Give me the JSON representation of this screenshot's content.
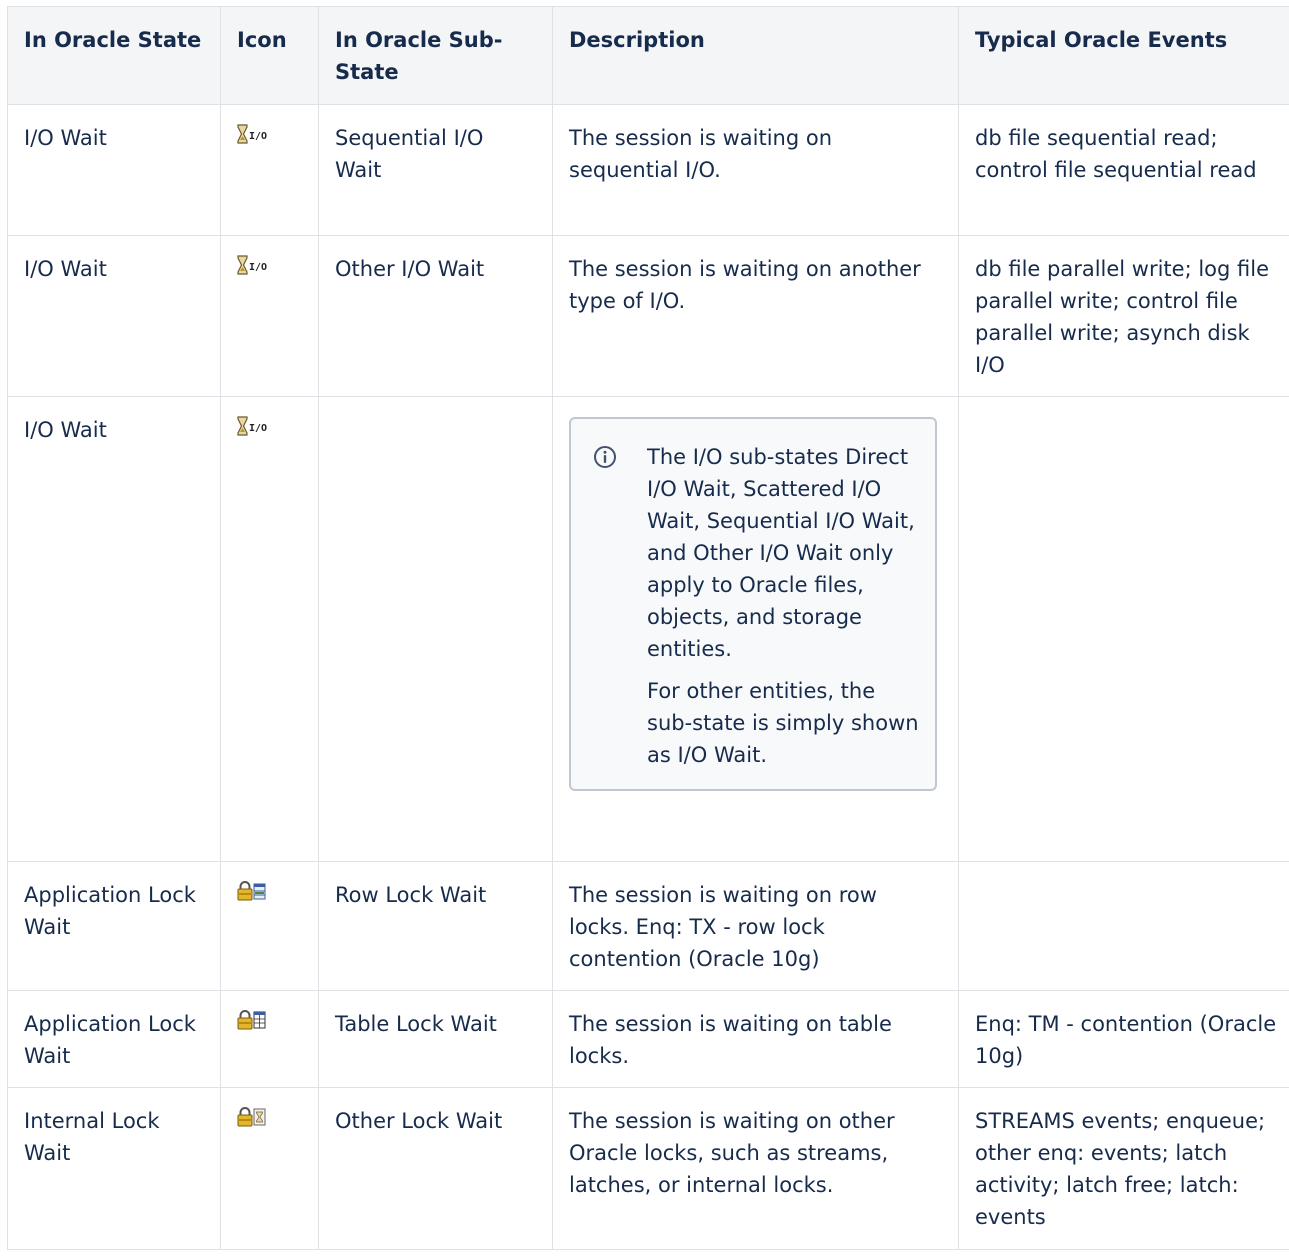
{
  "headers": {
    "state": "In Oracle State",
    "icon": "Icon",
    "substate": "In Oracle Sub-State",
    "description": "Description",
    "events": "Typical Oracle Events"
  },
  "rows": [
    {
      "state": "I/O Wait",
      "icon": "hourglass-io-icon",
      "substate": "Sequential I/O Wait",
      "description": "The session is waiting on sequential I/O.",
      "events": "db file sequential read; control file sequential read"
    },
    {
      "state": "I/O Wait",
      "icon": "hourglass-io-icon",
      "substate": "Other I/O Wait",
      "description": "The session is waiting on another type of I/O.",
      "events": "db file parallel write; log file parallel write; control file parallel write; asynch disk I/O"
    },
    {
      "state": "I/O Wait",
      "icon": "hourglass-io-icon",
      "substate": "",
      "note": {
        "paragraph1": "The I/O sub-states Direct I/O Wait, Scattered I/O Wait, Sequential I/O Wait, and Other I/O Wait only apply to Oracle files, objects, and storage entities.",
        "paragraph2": "For other entities, the sub-state is simply shown as I/O Wait."
      },
      "events": ""
    },
    {
      "state": "Application Lock Wait",
      "icon": "lock-row-icon",
      "substate": "Row Lock Wait",
      "description": "The session is waiting on row locks. Enq: TX - row lock contention (Oracle 10g)",
      "events": ""
    },
    {
      "state": "Application Lock Wait",
      "icon": "lock-table-icon",
      "substate": "Table Lock Wait",
      "description": "The session is waiting on table locks.",
      "events": "Enq: TM - contention (Oracle 10g)"
    },
    {
      "state": "Internal Lock Wait",
      "icon": "lock-other-icon",
      "substate": "Other Lock Wait",
      "description": "The session is waiting on other Oracle locks, such as streams, latches, or internal locks.",
      "events": "STREAMS events; enqueue; other enq: events; latch activity; latch free; latch: events"
    }
  ]
}
